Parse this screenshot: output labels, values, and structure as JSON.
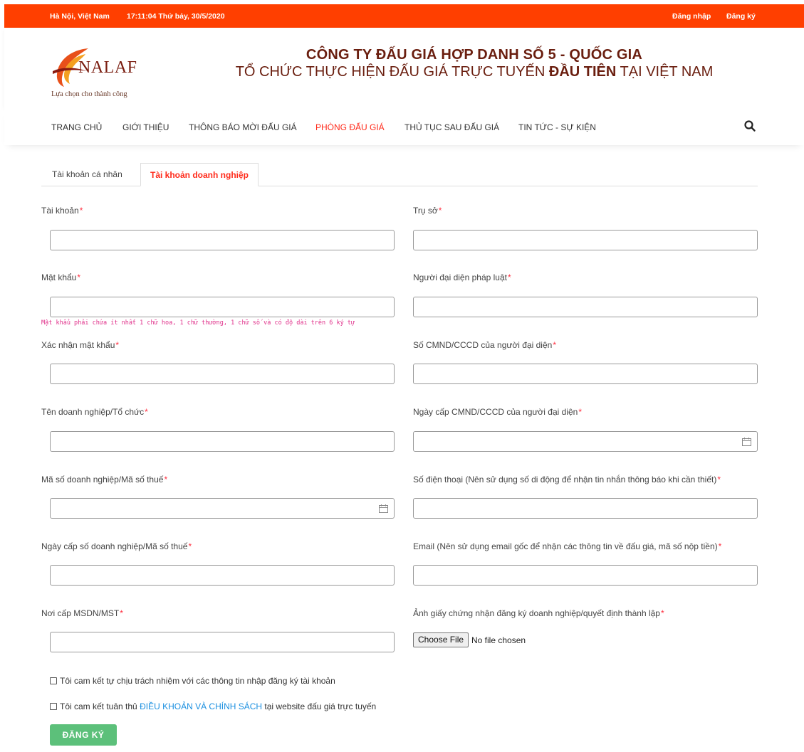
{
  "topbar": {
    "location": "Hà Nội, Việt Nam",
    "clock": "17:11:04 Thứ bảy, 30/5/2020",
    "login": "Đăng nhập",
    "register": "Đăng ký"
  },
  "header": {
    "logo_text": "NALAF",
    "logo_slogan": "Lựa chọn cho thành công",
    "company_line1": "CÔNG TY ĐẤU GIÁ HỢP DANH SỐ 5 - QUỐC GIA",
    "company_line2_prefix": "TỔ CHỨC THỰC HIỆN ĐẤU GIÁ TRỰC TUYẾN ",
    "company_line2_bold": "ĐẦU TIÊN",
    "company_line2_suffix": " TẠI VIỆT NAM"
  },
  "nav": {
    "items": [
      {
        "label": "TRANG CHỦ"
      },
      {
        "label": "GIỚI THIỆU"
      },
      {
        "label": "THÔNG BÁO MỜI ĐẤU GIÁ"
      },
      {
        "label": "PHÒNG ĐẤU GIÁ"
      },
      {
        "label": "THỦ TỤC SAU ĐẤU GIÁ"
      },
      {
        "label": "TIN TỨC - SỰ KIỆN"
      }
    ],
    "active_item": "PHÒNG ĐẤU GIÁ",
    "search_icon": "search-icon"
  },
  "tabs": {
    "personal": "Tài khoản cá nhân",
    "business": "Tài khoản doanh nghiệp",
    "active": "Tài khoản doanh nghiệp"
  },
  "form": {
    "left": [
      {
        "label": "Tài khoản",
        "required": "*",
        "value": ""
      },
      {
        "label": "Mật khẩu",
        "required": "*",
        "value": ""
      },
      {
        "label": "Xác nhận mật khẩu",
        "required": "*",
        "value": ""
      },
      {
        "label": "Tên doanh nghiệp/Tổ chức",
        "required": "*",
        "value": ""
      },
      {
        "label": "Mã số doanh nghiệp/Mã số thuế",
        "required": "*",
        "value": ""
      },
      {
        "label": "Ngày cấp số doanh nghiệp/Mã số thuế",
        "required": "*",
        "value": ""
      },
      {
        "label": "Nơi cấp MSDN/MST",
        "required": "*",
        "value": ""
      }
    ],
    "right": [
      {
        "label": "Trụ sở",
        "required": "*",
        "value": ""
      },
      {
        "label": "Người đại diện pháp luật",
        "required": "*",
        "value": ""
      },
      {
        "label": "Số CMND/CCCD của người đại diện",
        "required": "*",
        "value": ""
      },
      {
        "label": "Ngày cấp CMND/CCCD của người đại diện",
        "required": "*",
        "value": ""
      },
      {
        "label": "Số điện thoại (Nên sử dụng số di động để nhận tin nhắn thông báo khi cần thiết)",
        "required": "*",
        "value": ""
      },
      {
        "label": "Email (Nên sử dụng email gốc để nhận các thông tin về đấu giá, mã số nộp tiền)",
        "required": "*",
        "value": ""
      },
      {
        "label": "Ảnh giấy chứng nhận đăng ký doanh nghiệp/quyết định thành lập",
        "required": "*"
      }
    ],
    "password_hint": "Mật khẩu phải chứa ít nhất 1 chữ hoa, 1 chữ thường, 1 chữ số và có độ dài trên 6 ký tự",
    "file_button": "Choose File",
    "file_status": "No file chosen",
    "check1": "Tôi cam kết tự chịu trách nhiệm với các thông tin nhập đăng ký tài khoản",
    "check2_prefix": "Tôi cam kết tuân thủ ",
    "check2_link": "ĐIỀU KHOẢN VÀ CHÍNH SÁCH",
    "check2_suffix": " tại website đấu giá trực tuyến",
    "submit": "ĐĂNG KÝ"
  },
  "colors": {
    "topbar": "#ff3f00",
    "active_tab": "#ff2a1a",
    "brand_text": "#6a1e0f",
    "required": "#ff3040",
    "hint": "#e0308a",
    "link": "#1a8fe0",
    "submit": "#5cc07a"
  }
}
